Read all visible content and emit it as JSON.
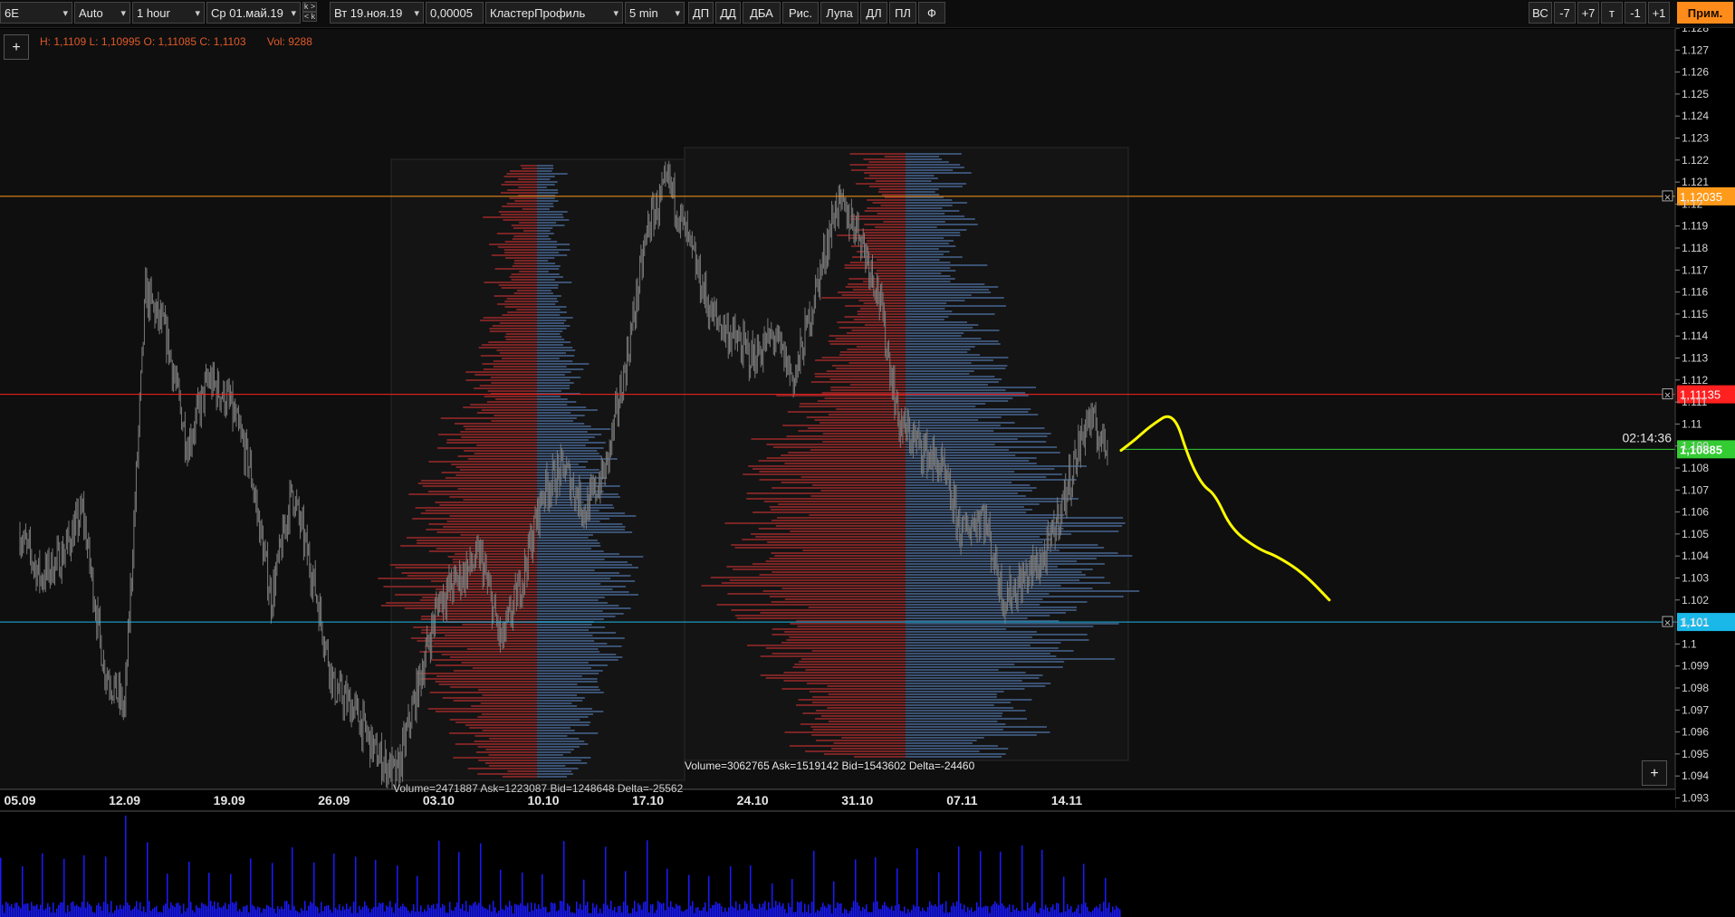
{
  "toolbar": {
    "symbol": "6E",
    "scale_mode": "Auto",
    "timeframe": "1 hour",
    "date_from": "Ср 01.май.19",
    "date_to": "Вт 19.ноя.19",
    "tick_size": "0,00005",
    "profile_type": "КластерПрофиль",
    "profile_period": "5 min",
    "nav_arrows": [
      "k >",
      "< k"
    ],
    "buttons": [
      "ДП",
      "ДД",
      "ДБА",
      "Рис.",
      "Лупа",
      "ДЛ",
      "ПЛ",
      "Ф"
    ],
    "right_buttons": [
      "ВС",
      "-7",
      "+7",
      "т",
      "-1",
      "+1"
    ],
    "apply_button": "Прим."
  },
  "info_line": {
    "ohlc": "H: 1,1109 L: 1,10995 O: 1,11085 C: 1,1103",
    "vol": "Vol: 9288"
  },
  "add_button": "+",
  "colors": {
    "background": "#000000",
    "candles": "#7a7a7a",
    "bid_profile": "#3a5172",
    "ask_profile": "#7a2424",
    "orange_line": "#ff9a1a",
    "red_line": "#ff2020",
    "green_line": "#33cc33",
    "cyan_line": "#1ab8e8",
    "drawing": "#ffff00",
    "volume_bars": "#1a1aff"
  },
  "chart_data": {
    "type": "line",
    "xlabel": "",
    "ylabel": "",
    "x_ticks": [
      "05.09",
      "12.09",
      "19.09",
      "26.09",
      "03.10",
      "10.10",
      "17.10",
      "24.10",
      "31.10",
      "07.11",
      "14.11"
    ],
    "y_ticks": [
      "1.128",
      "1.127",
      "1.126",
      "1.125",
      "1.124",
      "1.123",
      "1.122",
      "1.121",
      "1.12",
      "1.119",
      "1.118",
      "1.117",
      "1.116",
      "1.115",
      "1.114",
      "1.113",
      "1.112",
      "1.111",
      "1.11",
      "1.109",
      "1.108",
      "1.107",
      "1.106",
      "1.105",
      "1.104",
      "1.103",
      "1.102",
      "1.101",
      "1.1",
      "1.099",
      "1.098",
      "1.097",
      "1.096",
      "1.095",
      "1.094",
      "1.093"
    ],
    "ylim": [
      1.093,
      1.128
    ],
    "series": [
      {
        "values": [
          [
            "05.09",
            1.105
          ],
          [
            "06.09",
            1.103
          ],
          [
            "09.09",
            1.104
          ],
          [
            "10.09",
            1.106
          ],
          [
            "11.09",
            1.099
          ],
          [
            "12.09",
            1.097
          ],
          [
            "13.09",
            1.116
          ],
          [
            "16.09",
            1.114
          ],
          [
            "17.09",
            1.109
          ],
          [
            "18.09",
            1.112
          ],
          [
            "19.09",
            1.111
          ],
          [
            "20.09",
            1.108
          ],
          [
            "23.09",
            1.102
          ],
          [
            "24.09",
            1.107
          ],
          [
            "25.09",
            1.103
          ],
          [
            "26.09",
            1.098
          ],
          [
            "27.09",
            1.097
          ],
          [
            "30.09",
            1.095
          ],
          [
            "01.10",
            1.094
          ],
          [
            "02.10",
            1.098
          ],
          [
            "03.10",
            1.102
          ],
          [
            "04.10",
            1.103
          ],
          [
            "07.10",
            1.104
          ],
          [
            "08.10",
            1.1
          ],
          [
            "09.10",
            1.103
          ],
          [
            "10.10",
            1.107
          ],
          [
            "11.10",
            1.108
          ],
          [
            "14.10",
            1.106
          ],
          [
            "15.10",
            1.108
          ],
          [
            "16.10",
            1.113
          ],
          [
            "17.10",
            1.119
          ],
          [
            "18.10",
            1.121
          ],
          [
            "21.10",
            1.118
          ],
          [
            "22.10",
            1.115
          ],
          [
            "23.10",
            1.114
          ],
          [
            "24.10",
            1.113
          ],
          [
            "25.10",
            1.114
          ],
          [
            "28.10",
            1.112
          ],
          [
            "29.10",
            1.116
          ],
          [
            "30.10",
            1.12
          ],
          [
            "31.10",
            1.119
          ],
          [
            "01.11",
            1.116
          ],
          [
            "04.11",
            1.11
          ],
          [
            "05.11",
            1.109
          ],
          [
            "06.11",
            1.108
          ],
          [
            "07.11",
            1.105
          ],
          [
            "08.11",
            1.106
          ],
          [
            "11.11",
            1.102
          ],
          [
            "12.11",
            1.103
          ],
          [
            "13.11",
            1.104
          ],
          [
            "14.11",
            1.107
          ],
          [
            "15.11",
            1.1103
          ],
          [
            "18.11",
            1.1088
          ]
        ]
      }
    ],
    "horizontal_levels": [
      {
        "label": "1,12035",
        "value": 1.12035,
        "color": "#ff9a1a"
      },
      {
        "label": "1,11135",
        "value": 1.11135,
        "color": "#ff2020"
      },
      {
        "label": "1,10885",
        "value": 1.10885,
        "color": "#33cc33",
        "countdown": "02:14:36"
      },
      {
        "label": "1,101",
        "value": 1.101,
        "color": "#1ab8e8"
      }
    ],
    "volume_profiles": [
      {
        "stats": "Volume=2471887 Ask=1223087 Bid=1248648 Delta=-25562",
        "from": "30.09",
        "to": "18.10"
      },
      {
        "stats": "Volume=3062765 Ask=1519142 Bid=1543602 Delta=-24460",
        "from": "18.10",
        "to": "15.11"
      }
    ],
    "forecast_drawing": [
      [
        1.1088,
        0
      ],
      [
        1.1093,
        1
      ],
      [
        1.1099,
        2
      ],
      [
        1.1106,
        3
      ],
      [
        1.1084,
        4
      ],
      [
        1.1072,
        5
      ],
      [
        1.1068,
        6
      ],
      [
        1.1052,
        7
      ],
      [
        1.1043,
        8
      ],
      [
        1.104,
        9
      ],
      [
        1.1032,
        10
      ],
      [
        1.102,
        11
      ]
    ]
  }
}
